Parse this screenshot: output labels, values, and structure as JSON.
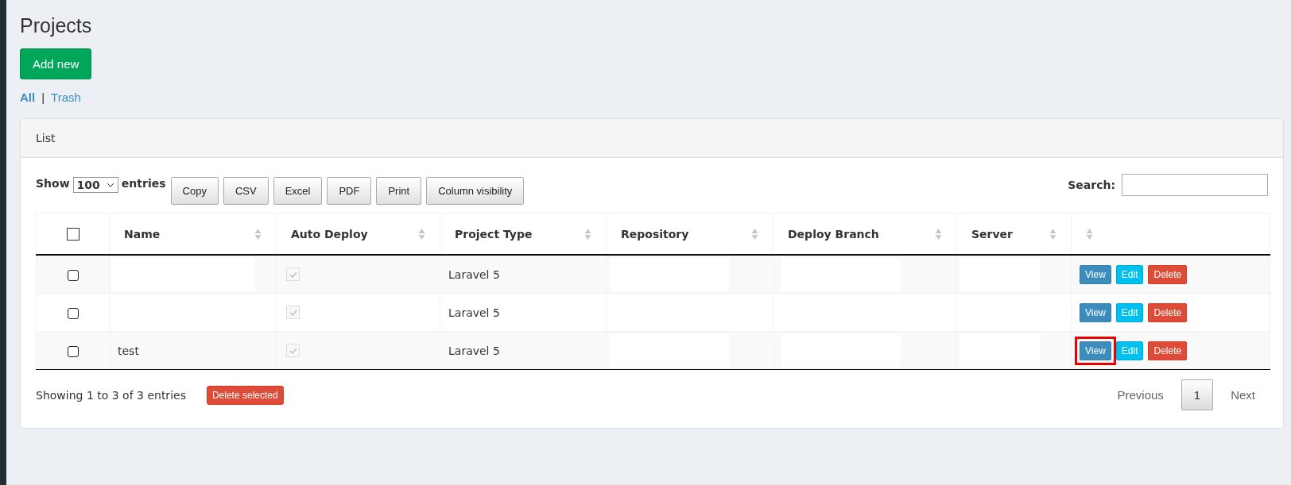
{
  "page_title": "Projects",
  "add_button": "Add new",
  "filters": [
    {
      "label": "All",
      "selected": true
    },
    {
      "label": "Trash",
      "selected": false
    }
  ],
  "separator": "|",
  "panel": {
    "title": "List"
  },
  "length_menu": {
    "prefix": "Show",
    "value": "100",
    "suffix": "entries"
  },
  "export_buttons": [
    "Copy",
    "CSV",
    "Excel",
    "PDF",
    "Print",
    "Column visibility"
  ],
  "search": {
    "label": "Search:"
  },
  "table": {
    "select_all_checked": false,
    "columns": [
      "Name",
      "Auto Deploy",
      "Project Type",
      "Repository",
      "Deploy Branch",
      "Server",
      ""
    ],
    "rows": [
      {
        "checked": false,
        "name": "",
        "auto_deploy": true,
        "project_type": "Laravel 5",
        "actions": [
          "View",
          "Edit",
          "Delete"
        ],
        "highlighted": false
      },
      {
        "checked": false,
        "name": "",
        "auto_deploy": true,
        "project_type": "Laravel 5",
        "actions": [
          "View",
          "Edit",
          "Delete"
        ],
        "highlighted": false
      },
      {
        "checked": false,
        "name": "test",
        "auto_deploy": true,
        "project_type": "Laravel 5",
        "actions": [
          "View",
          "Edit",
          "Delete"
        ],
        "highlighted": true
      }
    ]
  },
  "info": "Showing 1 to 3 of 3 entries",
  "delete_selected": "Delete selected",
  "pagination": [
    {
      "label": "Previous",
      "selected": false
    },
    {
      "label": "1",
      "selected": true
    },
    {
      "label": "Next",
      "selected": false
    }
  ]
}
